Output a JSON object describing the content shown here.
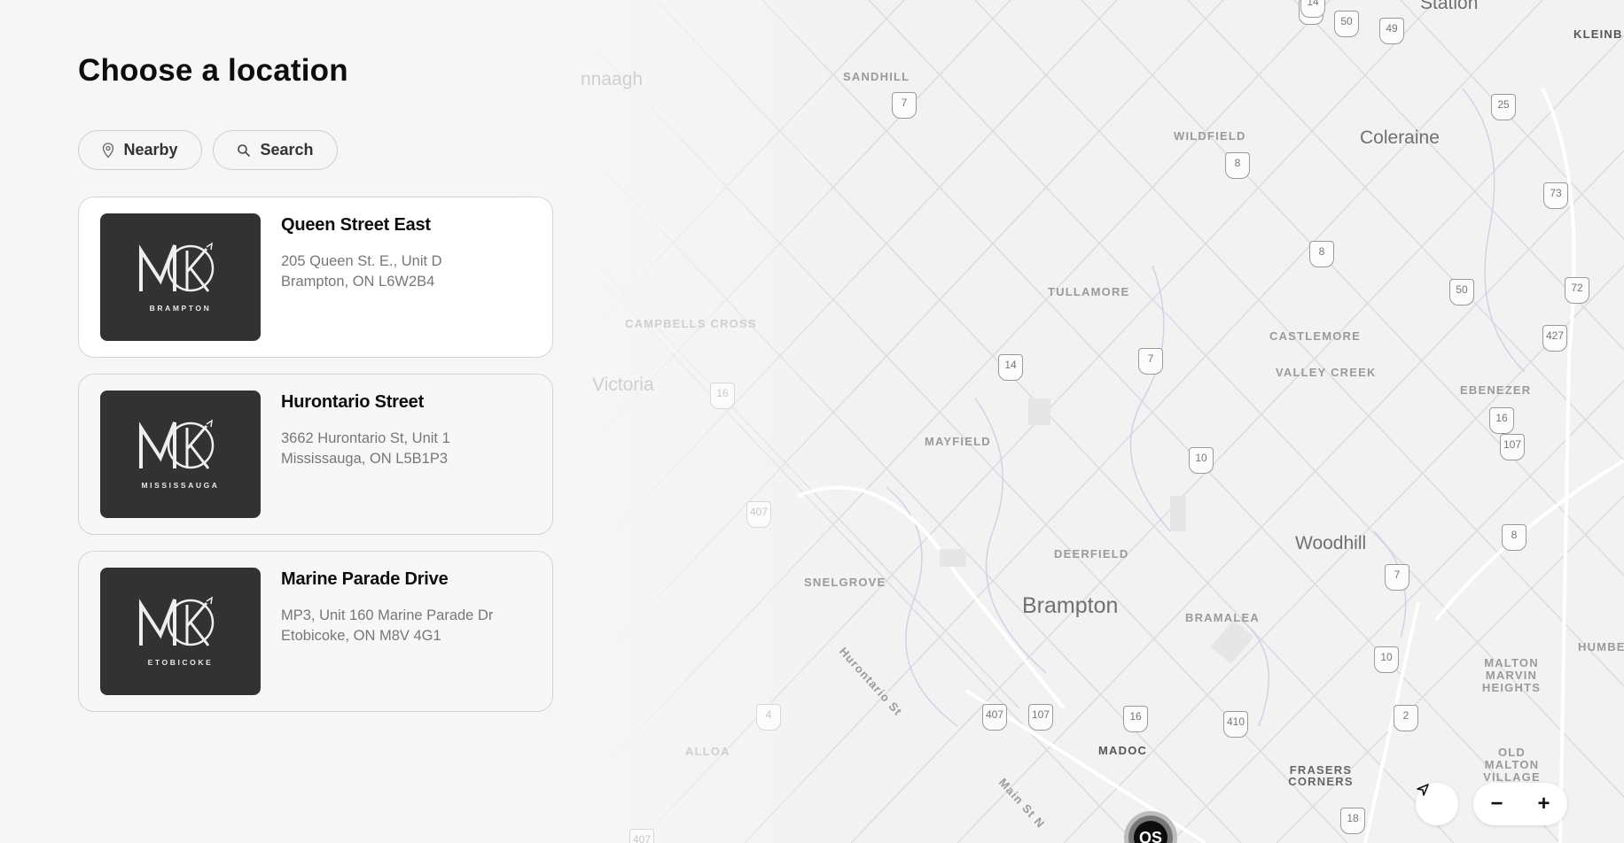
{
  "page": {
    "title": "Choose a location"
  },
  "filters": {
    "nearby_label": "Nearby",
    "search_label": "Search",
    "nearby_icon": "location-pin-icon",
    "search_icon": "search-icon"
  },
  "locations": [
    {
      "name": "Queen Street East",
      "address_line1": "205 Queen St. E., Unit D",
      "address_line2": "Brampton, ON L6W2B4",
      "logo_city": "BRAMPTON",
      "selected": true
    },
    {
      "name": "Hurontario Street",
      "address_line1": "3662 Hurontario St, Unit 1",
      "address_line2": "Mississauga, ON L5B1P3",
      "logo_city": "MISSISSAUGA",
      "selected": false
    },
    {
      "name": "Marine Parade Drive",
      "address_line1": "MP3, Unit 160 Marine Parade Dr",
      "address_line2": "Etobicoke, ON M8V 4G1",
      "logo_city": "ETOBICOKE",
      "selected": false
    }
  ],
  "map": {
    "labels": {
      "station": "Station",
      "kleinb": "KLEINB",
      "sandhill": "SANDHILL",
      "wildfield": "WILDFIELD",
      "coleraine": "Coleraine",
      "tullamore": "TULLAMORE",
      "castlemore": "CASTLEMORE",
      "valley_creek": "VALLEY CREEK",
      "ebenezer": "EBENEZER",
      "mayfield": "MAYFIELD",
      "woodhill": "Woodhill",
      "deerfield": "DEERFIELD",
      "snelgrove": "SNELGROVE",
      "brampton": "Brampton",
      "bramalea": "BRAMALEA",
      "hurontario_st": "Hurontario St",
      "madoc": "MADOC",
      "main_st_n": "Main St N",
      "frasers_corners": "FRASERS CORNERS",
      "malton_marvin_heights": "MALTON MARVIN HEIGHTS",
      "old_malton_village": "OLD MALTON VILLAGE",
      "humbe": "HUMBE",
      "alloa": "ALLOA",
      "campbells_cross": "CAMPBELLS CROSS",
      "victoria": "Victoria",
      "inglewood": "nnaagh"
    },
    "highway_shields": [
      "14",
      "50",
      "49",
      "25",
      "7",
      "8",
      "73",
      "8",
      "50",
      "72",
      "427",
      "14",
      "7",
      "16",
      "10",
      "16",
      "107",
      "8",
      "407",
      "10",
      "7",
      "2",
      "407",
      "107",
      "16",
      "410",
      "4",
      "18",
      "407",
      "14"
    ],
    "marker_label": "QS",
    "controls": {
      "locate_icon": "navigation-arrow-icon",
      "zoom_out": "−",
      "zoom_in": "+"
    }
  }
}
